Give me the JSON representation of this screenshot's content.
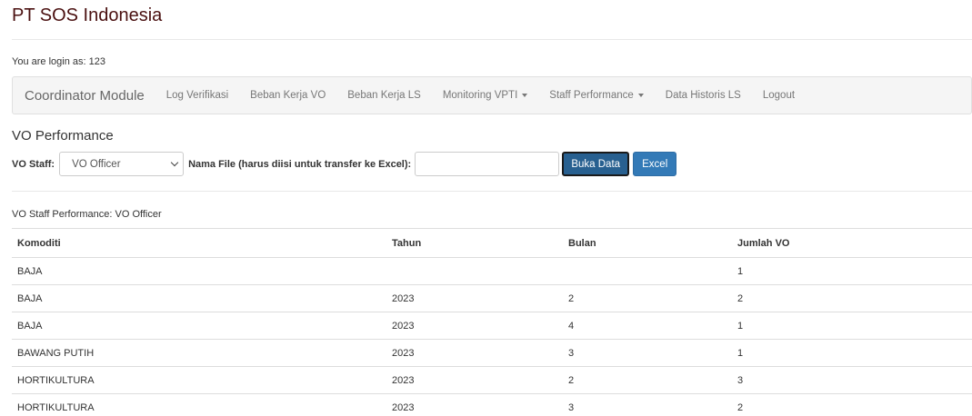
{
  "app": {
    "title": "PT SOS Indonesia",
    "login_text": "You are login as: 123"
  },
  "navbar": {
    "brand": "Coordinator Module",
    "items": [
      {
        "label": "Log Verifikasi",
        "dropdown": false
      },
      {
        "label": "Beban Kerja VO",
        "dropdown": false
      },
      {
        "label": "Beban Kerja LS",
        "dropdown": false
      },
      {
        "label": "Monitoring VPTI",
        "dropdown": true
      },
      {
        "label": "Staff Performance",
        "dropdown": true
      },
      {
        "label": "Data Historis LS",
        "dropdown": false
      },
      {
        "label": "Logout",
        "dropdown": false
      }
    ]
  },
  "section": {
    "title": "VO Performance"
  },
  "form": {
    "staff_label": "VO Staff:",
    "staff_selected": "VO Officer",
    "file_label": "Nama File (harus diisi untuk transfer ke Excel):",
    "file_value": "",
    "open_button": "Buka Data",
    "excel_button": "Excel"
  },
  "results": {
    "caption": "VO Staff Performance: VO Officer",
    "columns": [
      "Komoditi",
      "Tahun",
      "Bulan",
      "Jumlah VO"
    ],
    "rows": [
      [
        "BAJA",
        "",
        "",
        "1"
      ],
      [
        "BAJA",
        "2023",
        "2",
        "2"
      ],
      [
        "BAJA",
        "2023",
        "4",
        "1"
      ],
      [
        "BAWANG PUTIH",
        "2023",
        "3",
        "1"
      ],
      [
        "HORTIKULTURA",
        "2023",
        "2",
        "3"
      ],
      [
        "HORTIKULTURA",
        "2023",
        "3",
        "2"
      ]
    ]
  },
  "colors": {
    "title": "#4a1010",
    "primary_button": "#286090",
    "excel_button": "#337ab7",
    "navbar_bg": "#f5f5f5"
  }
}
